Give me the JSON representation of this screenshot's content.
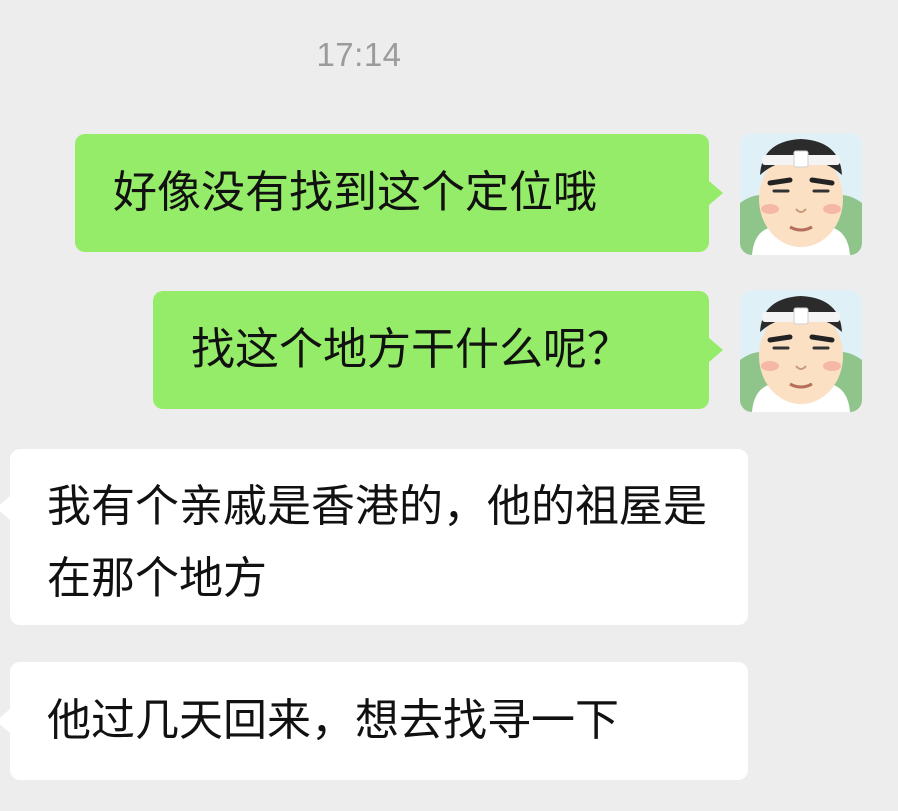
{
  "chat": {
    "timestamp": "17:14",
    "messages": [
      {
        "side": "out",
        "text": "好像没有找到这个定位哦",
        "avatar": "cartoon-man-avatar"
      },
      {
        "side": "out",
        "text": "找这个地方干什么呢？",
        "avatar": "cartoon-man-avatar"
      },
      {
        "side": "in",
        "text": "我有个亲戚是香港的，他的祖屋是在那个地方"
      },
      {
        "side": "in",
        "text": "他过几天回来，想去找寻一下"
      }
    ]
  },
  "colors": {
    "background": "#ededed",
    "outgoing_bubble": "#95ec69",
    "incoming_bubble": "#ffffff",
    "timestamp_text": "#9b9b9b",
    "message_text": "#111111"
  }
}
